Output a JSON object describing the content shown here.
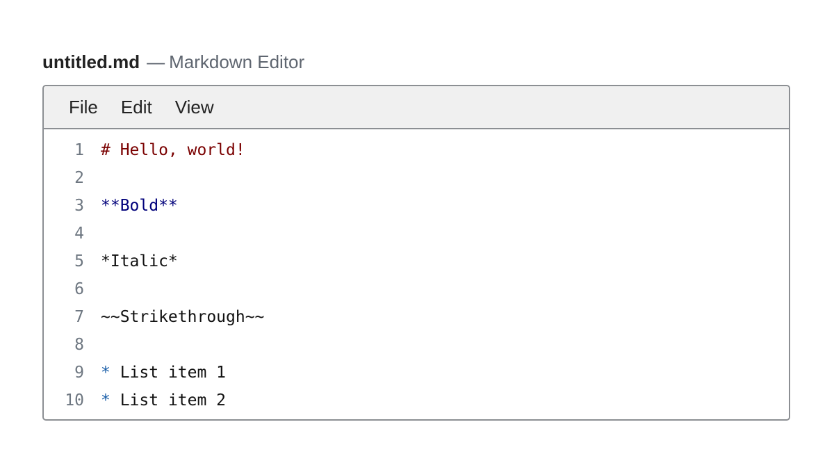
{
  "header": {
    "file_name": "untitled.md",
    "separator": "—",
    "app_name": "Markdown Editor"
  },
  "menu": {
    "items": [
      {
        "label": "File"
      },
      {
        "label": "Edit"
      },
      {
        "label": "View"
      }
    ]
  },
  "editor": {
    "lines": [
      {
        "number": "1",
        "tokens": [
          {
            "text": "# Hello, world!",
            "kind": "heading"
          }
        ]
      },
      {
        "number": "2",
        "tokens": [
          {
            "text": "",
            "kind": "text"
          }
        ]
      },
      {
        "number": "3",
        "tokens": [
          {
            "text": "**Bold**",
            "kind": "strong"
          }
        ]
      },
      {
        "number": "4",
        "tokens": [
          {
            "text": "",
            "kind": "text"
          }
        ]
      },
      {
        "number": "5",
        "tokens": [
          {
            "text": "*Italic*",
            "kind": "em"
          }
        ]
      },
      {
        "number": "6",
        "tokens": [
          {
            "text": "",
            "kind": "text"
          }
        ]
      },
      {
        "number": "7",
        "tokens": [
          {
            "text": "~~Strikethrough~~",
            "kind": "strike"
          }
        ]
      },
      {
        "number": "8",
        "tokens": [
          {
            "text": "",
            "kind": "text"
          }
        ]
      },
      {
        "number": "9",
        "tokens": [
          {
            "text": "*",
            "kind": "bullet"
          },
          {
            "text": " List item 1",
            "kind": "text"
          }
        ]
      },
      {
        "number": "10",
        "tokens": [
          {
            "text": "*",
            "kind": "bullet"
          },
          {
            "text": " List item 2",
            "kind": "text"
          }
        ]
      }
    ]
  },
  "colors": {
    "heading": "#7a0000",
    "strong": "#00007a",
    "bullet": "#1a5ea8",
    "line_number": "#6e7781",
    "menu_background": "#f0f0f0",
    "border": "#8c8f93"
  }
}
